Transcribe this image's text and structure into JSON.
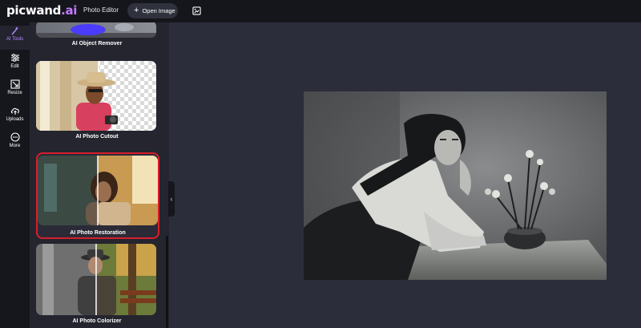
{
  "app": {
    "logo_main": "picwand",
    "logo_dot": ".",
    "logo_accent": "ai",
    "section_label": "Photo Editor",
    "open_image_label": "Open Image"
  },
  "rail": {
    "items": [
      {
        "label": "AI Tools",
        "icon": "magic-wand-icon",
        "active": true
      },
      {
        "label": "Edit",
        "icon": "sliders-icon"
      },
      {
        "label": "Resize",
        "icon": "resize-icon"
      },
      {
        "label": "Uploads",
        "icon": "cloud-upload-icon"
      },
      {
        "label": "More",
        "icon": "more-icon"
      }
    ]
  },
  "tools": [
    {
      "title": "AI Object Remover"
    },
    {
      "title": "AI Photo Cutout"
    },
    {
      "title": "AI Photo Restoration",
      "selected": true
    },
    {
      "title": "AI Photo Colorizer"
    }
  ],
  "colors": {
    "accent": "#b58cff",
    "selected_border": "#d81e2b",
    "topbar": "#15151c",
    "canvas": "#2b2d3a"
  }
}
